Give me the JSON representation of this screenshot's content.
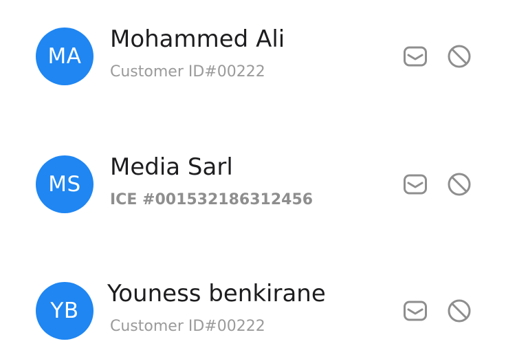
{
  "customers": [
    {
      "initials": "MA",
      "name": "Mohammed Ali",
      "subtitle": "Customer ID#00222"
    },
    {
      "initials": "MS",
      "name": "Media Sarl",
      "subtitle": "ICE #001532186312456"
    },
    {
      "initials": "YB",
      "name": "Youness benkirane",
      "subtitle": "Customer ID#00222"
    }
  ],
  "icons": {
    "message": "message-icon",
    "block": "block-icon"
  },
  "colors": {
    "avatar_bg": "#1f86f2",
    "icon_gray": "#8e8e8e",
    "name_text": "#1d1d1f",
    "sub_text": "#9a9a9a"
  }
}
